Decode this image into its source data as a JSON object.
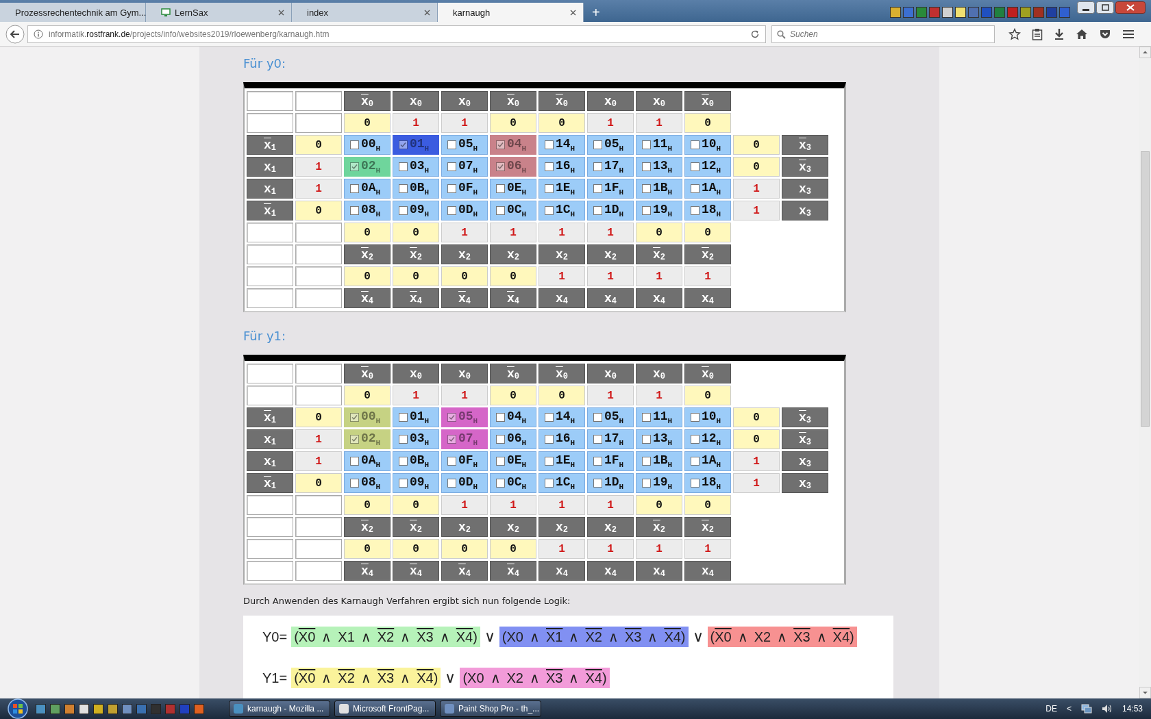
{
  "browser": {
    "tabs": [
      {
        "title": "Prozessrechentechnik am Gym...",
        "selected": false,
        "favicon": false,
        "closable": false
      },
      {
        "title": "LernSax",
        "selected": false,
        "favicon": true,
        "closable": true
      },
      {
        "title": "index",
        "selected": false,
        "favicon": false,
        "closable": true
      },
      {
        "title": "karnaugh",
        "selected": true,
        "favicon": false,
        "closable": true
      }
    ],
    "new_tab": "+",
    "url": {
      "prefix": "informatik.",
      "domain": "rostfrank.de",
      "path": "/projects/info/websites2019/rloewenberg/karnaugh.htm"
    },
    "search": {
      "placeholder": "Suchen"
    }
  },
  "maps": [
    {
      "heading": "Für y0:",
      "top_headers": [
        {
          "name": "x",
          "sub": "0",
          "negated": true
        },
        {
          "name": "x",
          "sub": "0",
          "negated": false
        },
        {
          "name": "x",
          "sub": "0",
          "negated": false
        },
        {
          "name": "x",
          "sub": "0",
          "negated": true
        },
        {
          "name": "x",
          "sub": "0",
          "negated": true
        },
        {
          "name": "x",
          "sub": "0",
          "negated": false
        },
        {
          "name": "x",
          "sub": "0",
          "negated": false
        },
        {
          "name": "x",
          "sub": "0",
          "negated": true
        }
      ],
      "top_values": [
        {
          "text": "0",
          "on": false
        },
        {
          "text": "1",
          "on": true
        },
        {
          "text": "1",
          "on": true
        },
        {
          "text": "0",
          "on": false
        },
        {
          "text": "0",
          "on": false
        },
        {
          "text": "1",
          "on": true
        },
        {
          "text": "1",
          "on": true
        },
        {
          "text": "0",
          "on": false
        }
      ],
      "rows": [
        {
          "left_header": {
            "name": "x",
            "sub": "1",
            "negated": true
          },
          "left_value": {
            "text": "0",
            "on": false
          },
          "right_value": {
            "text": "0",
            "on": false
          },
          "right_header": {
            "name": "x",
            "sub": "3",
            "negated": true
          },
          "cells": [
            {
              "code": "00",
              "sub": "H",
              "checked": false
            },
            {
              "code": "01",
              "sub": "H",
              "checked": true,
              "color": "#3b5ce0"
            },
            {
              "code": "05",
              "sub": "H",
              "checked": false
            },
            {
              "code": "04",
              "sub": "H",
              "checked": true,
              "color": "#c9828a"
            },
            {
              "code": "14",
              "sub": "H",
              "checked": false
            },
            {
              "code": "05",
              "sub": "H",
              "checked": false
            },
            {
              "code": "11",
              "sub": "H",
              "checked": false
            },
            {
              "code": "10",
              "sub": "H",
              "checked": false
            }
          ]
        },
        {
          "left_header": {
            "name": "x",
            "sub": "1",
            "negated": false
          },
          "left_value": {
            "text": "1",
            "on": true
          },
          "right_value": {
            "text": "0",
            "on": false
          },
          "right_header": {
            "name": "x",
            "sub": "3",
            "negated": true
          },
          "cells": [
            {
              "code": "02",
              "sub": "H",
              "checked": true,
              "color": "#6fd59c"
            },
            {
              "code": "03",
              "sub": "H",
              "checked": false
            },
            {
              "code": "07",
              "sub": "H",
              "checked": false
            },
            {
              "code": "06",
              "sub": "H",
              "checked": true,
              "color": "#c9828a"
            },
            {
              "code": "16",
              "sub": "H",
              "checked": false
            },
            {
              "code": "17",
              "sub": "H",
              "checked": false
            },
            {
              "code": "13",
              "sub": "H",
              "checked": false
            },
            {
              "code": "12",
              "sub": "H",
              "checked": false
            }
          ]
        },
        {
          "left_header": {
            "name": "x",
            "sub": "1",
            "negated": false
          },
          "left_value": {
            "text": "1",
            "on": true
          },
          "right_value": {
            "text": "1",
            "on": true
          },
          "right_header": {
            "name": "x",
            "sub": "3",
            "negated": false
          },
          "cells": [
            {
              "code": "0A",
              "sub": "H",
              "checked": false
            },
            {
              "code": "0B",
              "sub": "H",
              "checked": false
            },
            {
              "code": "0F",
              "sub": "H",
              "checked": false
            },
            {
              "code": "0E",
              "sub": "H",
              "checked": false
            },
            {
              "code": "1E",
              "sub": "H",
              "checked": false
            },
            {
              "code": "1F",
              "sub": "H",
              "checked": false
            },
            {
              "code": "1B",
              "sub": "H",
              "checked": false
            },
            {
              "code": "1A",
              "sub": "H",
              "checked": false
            }
          ]
        },
        {
          "left_header": {
            "name": "x",
            "sub": "1",
            "negated": true
          },
          "left_value": {
            "text": "0",
            "on": false
          },
          "right_value": {
            "text": "1",
            "on": true
          },
          "right_header": {
            "name": "x",
            "sub": "3",
            "negated": false
          },
          "cells": [
            {
              "code": "08",
              "sub": "H",
              "checked": false
            },
            {
              "code": "09",
              "sub": "H",
              "checked": false
            },
            {
              "code": "0D",
              "sub": "H",
              "checked": false
            },
            {
              "code": "0C",
              "sub": "H",
              "checked": false
            },
            {
              "code": "1C",
              "sub": "H",
              "checked": false
            },
            {
              "code": "1D",
              "sub": "H",
              "checked": false
            },
            {
              "code": "19",
              "sub": "H",
              "checked": false
            },
            {
              "code": "18",
              "sub": "H",
              "checked": false
            }
          ]
        }
      ],
      "bottom_values_1": [
        {
          "text": "0",
          "on": false
        },
        {
          "text": "0",
          "on": false
        },
        {
          "text": "1",
          "on": true
        },
        {
          "text": "1",
          "on": true
        },
        {
          "text": "1",
          "on": true
        },
        {
          "text": "1",
          "on": true
        },
        {
          "text": "0",
          "on": false
        },
        {
          "text": "0",
          "on": false
        }
      ],
      "bottom_headers_1": [
        {
          "name": "x",
          "sub": "2",
          "negated": true
        },
        {
          "name": "x",
          "sub": "2",
          "negated": true
        },
        {
          "name": "x",
          "sub": "2",
          "negated": false
        },
        {
          "name": "x",
          "sub": "2",
          "negated": false
        },
        {
          "name": "x",
          "sub": "2",
          "negated": false
        },
        {
          "name": "x",
          "sub": "2",
          "negated": false
        },
        {
          "name": "x",
          "sub": "2",
          "negated": true
        },
        {
          "name": "x",
          "sub": "2",
          "negated": true
        }
      ],
      "bottom_values_2": [
        {
          "text": "0",
          "on": false
        },
        {
          "text": "0",
          "on": false
        },
        {
          "text": "0",
          "on": false
        },
        {
          "text": "0",
          "on": false
        },
        {
          "text": "1",
          "on": true
        },
        {
          "text": "1",
          "on": true
        },
        {
          "text": "1",
          "on": true
        },
        {
          "text": "1",
          "on": true
        }
      ],
      "bottom_headers_2": [
        {
          "name": "x",
          "sub": "4",
          "negated": true
        },
        {
          "name": "x",
          "sub": "4",
          "negated": true
        },
        {
          "name": "x",
          "sub": "4",
          "negated": true
        },
        {
          "name": "x",
          "sub": "4",
          "negated": true
        },
        {
          "name": "x",
          "sub": "4",
          "negated": false
        },
        {
          "name": "x",
          "sub": "4",
          "negated": false
        },
        {
          "name": "x",
          "sub": "4",
          "negated": false
        },
        {
          "name": "x",
          "sub": "4",
          "negated": false
        }
      ]
    },
    {
      "heading": "Für y1:",
      "top_headers": [
        {
          "name": "x",
          "sub": "0",
          "negated": true
        },
        {
          "name": "x",
          "sub": "0",
          "negated": false
        },
        {
          "name": "x",
          "sub": "0",
          "negated": false
        },
        {
          "name": "x",
          "sub": "0",
          "negated": true
        },
        {
          "name": "x",
          "sub": "0",
          "negated": true
        },
        {
          "name": "x",
          "sub": "0",
          "negated": false
        },
        {
          "name": "x",
          "sub": "0",
          "negated": false
        },
        {
          "name": "x",
          "sub": "0",
          "negated": true
        }
      ],
      "top_values": [
        {
          "text": "0",
          "on": false
        },
        {
          "text": "1",
          "on": true
        },
        {
          "text": "1",
          "on": true
        },
        {
          "text": "0",
          "on": false
        },
        {
          "text": "0",
          "on": false
        },
        {
          "text": "1",
          "on": true
        },
        {
          "text": "1",
          "on": true
        },
        {
          "text": "0",
          "on": false
        }
      ],
      "rows": [
        {
          "left_header": {
            "name": "x",
            "sub": "1",
            "negated": true
          },
          "left_value": {
            "text": "0",
            "on": false
          },
          "right_value": {
            "text": "0",
            "on": false
          },
          "right_header": {
            "name": "x",
            "sub": "3",
            "negated": true
          },
          "cells": [
            {
              "code": "00",
              "sub": "H",
              "checked": true,
              "color": "#c6d283"
            },
            {
              "code": "01",
              "sub": "H",
              "checked": false
            },
            {
              "code": "05",
              "sub": "H",
              "checked": true,
              "color": "#d566c8"
            },
            {
              "code": "04",
              "sub": "H",
              "checked": false
            },
            {
              "code": "14",
              "sub": "H",
              "checked": false
            },
            {
              "code": "05",
              "sub": "H",
              "checked": false
            },
            {
              "code": "11",
              "sub": "H",
              "checked": false
            },
            {
              "code": "10",
              "sub": "H",
              "checked": false
            }
          ]
        },
        {
          "left_header": {
            "name": "x",
            "sub": "1",
            "negated": false
          },
          "left_value": {
            "text": "1",
            "on": true
          },
          "right_value": {
            "text": "0",
            "on": false
          },
          "right_header": {
            "name": "x",
            "sub": "3",
            "negated": true
          },
          "cells": [
            {
              "code": "02",
              "sub": "H",
              "checked": true,
              "color": "#c6d283"
            },
            {
              "code": "03",
              "sub": "H",
              "checked": false
            },
            {
              "code": "07",
              "sub": "H",
              "checked": true,
              "color": "#d566c8"
            },
            {
              "code": "06",
              "sub": "H",
              "checked": false
            },
            {
              "code": "16",
              "sub": "H",
              "checked": false
            },
            {
              "code": "17",
              "sub": "H",
              "checked": false
            },
            {
              "code": "13",
              "sub": "H",
              "checked": false
            },
            {
              "code": "12",
              "sub": "H",
              "checked": false
            }
          ]
        },
        {
          "left_header": {
            "name": "x",
            "sub": "1",
            "negated": false
          },
          "left_value": {
            "text": "1",
            "on": true
          },
          "right_value": {
            "text": "1",
            "on": true
          },
          "right_header": {
            "name": "x",
            "sub": "3",
            "negated": false
          },
          "cells": [
            {
              "code": "0A",
              "sub": "H",
              "checked": false
            },
            {
              "code": "0B",
              "sub": "H",
              "checked": false
            },
            {
              "code": "0F",
              "sub": "H",
              "checked": false
            },
            {
              "code": "0E",
              "sub": "H",
              "checked": false
            },
            {
              "code": "1E",
              "sub": "H",
              "checked": false
            },
            {
              "code": "1F",
              "sub": "H",
              "checked": false
            },
            {
              "code": "1B",
              "sub": "H",
              "checked": false
            },
            {
              "code": "1A",
              "sub": "H",
              "checked": false
            }
          ]
        },
        {
          "left_header": {
            "name": "x",
            "sub": "1",
            "negated": true
          },
          "left_value": {
            "text": "0",
            "on": false
          },
          "right_value": {
            "text": "1",
            "on": true
          },
          "right_header": {
            "name": "x",
            "sub": "3",
            "negated": false
          },
          "cells": [
            {
              "code": "08",
              "sub": "H",
              "checked": false
            },
            {
              "code": "09",
              "sub": "H",
              "checked": false
            },
            {
              "code": "0D",
              "sub": "H",
              "checked": false
            },
            {
              "code": "0C",
              "sub": "H",
              "checked": false
            },
            {
              "code": "1C",
              "sub": "H",
              "checked": false
            },
            {
              "code": "1D",
              "sub": "H",
              "checked": false
            },
            {
              "code": "19",
              "sub": "H",
              "checked": false
            },
            {
              "code": "18",
              "sub": "H",
              "checked": false
            }
          ]
        }
      ],
      "bottom_values_1": [
        {
          "text": "0",
          "on": false
        },
        {
          "text": "0",
          "on": false
        },
        {
          "text": "1",
          "on": true
        },
        {
          "text": "1",
          "on": true
        },
        {
          "text": "1",
          "on": true
        },
        {
          "text": "1",
          "on": true
        },
        {
          "text": "0",
          "on": false
        },
        {
          "text": "0",
          "on": false
        }
      ],
      "bottom_headers_1": [
        {
          "name": "x",
          "sub": "2",
          "negated": true
        },
        {
          "name": "x",
          "sub": "2",
          "negated": true
        },
        {
          "name": "x",
          "sub": "2",
          "negated": false
        },
        {
          "name": "x",
          "sub": "2",
          "negated": false
        },
        {
          "name": "x",
          "sub": "2",
          "negated": false
        },
        {
          "name": "x",
          "sub": "2",
          "negated": false
        },
        {
          "name": "x",
          "sub": "2",
          "negated": true
        },
        {
          "name": "x",
          "sub": "2",
          "negated": true
        }
      ],
      "bottom_values_2": [
        {
          "text": "0",
          "on": false
        },
        {
          "text": "0",
          "on": false
        },
        {
          "text": "0",
          "on": false
        },
        {
          "text": "0",
          "on": false
        },
        {
          "text": "1",
          "on": true
        },
        {
          "text": "1",
          "on": true
        },
        {
          "text": "1",
          "on": true
        },
        {
          "text": "1",
          "on": true
        }
      ],
      "bottom_headers_2": [
        {
          "name": "x",
          "sub": "4",
          "negated": true
        },
        {
          "name": "x",
          "sub": "4",
          "negated": true
        },
        {
          "name": "x",
          "sub": "4",
          "negated": true
        },
        {
          "name": "x",
          "sub": "4",
          "negated": true
        },
        {
          "name": "x",
          "sub": "4",
          "negated": false
        },
        {
          "name": "x",
          "sub": "4",
          "negated": false
        },
        {
          "name": "x",
          "sub": "4",
          "negated": false
        },
        {
          "name": "x",
          "sub": "4",
          "negated": false
        }
      ]
    }
  ],
  "logic": {
    "intro": "Durch Anwenden des Karnaugh Verfahren ergibt sich nun folgende Logik:",
    "and": "∧",
    "or": "∨",
    "open": "(",
    "close": ")",
    "equations": [
      {
        "label": "Y0=",
        "terms": [
          {
            "color": "#b6f2b9",
            "literals": [
              {
                "name": "X0",
                "negated": true
              },
              {
                "name": "X1",
                "negated": false
              },
              {
                "name": "X2",
                "negated": true
              },
              {
                "name": "X3",
                "negated": true
              },
              {
                "name": "X4",
                "negated": true
              }
            ]
          },
          {
            "color": "#8190f2",
            "literals": [
              {
                "name": "X0",
                "negated": false
              },
              {
                "name": "X1",
                "negated": true
              },
              {
                "name": "X2",
                "negated": true
              },
              {
                "name": "X3",
                "negated": true
              },
              {
                "name": "X4",
                "negated": true
              }
            ]
          },
          {
            "color": "#f79191",
            "literals": [
              {
                "name": "X0",
                "negated": true
              },
              {
                "name": "X2",
                "negated": false
              },
              {
                "name": "X3",
                "negated": true
              },
              {
                "name": "X4",
                "negated": true
              }
            ]
          }
        ]
      },
      {
        "label": "Y1=",
        "terms": [
          {
            "color": "#faf39b",
            "literals": [
              {
                "name": "X0",
                "negated": true
              },
              {
                "name": "X2",
                "negated": true
              },
              {
                "name": "X3",
                "negated": true
              },
              {
                "name": "X4",
                "negated": true
              }
            ]
          },
          {
            "color": "#f29bd9",
            "literals": [
              {
                "name": "X0",
                "negated": false
              },
              {
                "name": "X2",
                "negated": false
              },
              {
                "name": "X3",
                "negated": true
              },
              {
                "name": "X4",
                "negated": true
              }
            ]
          }
        ]
      }
    ]
  },
  "taskbar": {
    "tasks": [
      {
        "label": "karnaugh - Mozilla ..."
      },
      {
        "label": "Microsoft FrontPag..."
      },
      {
        "label": "Paint Shop Pro - th_..."
      }
    ],
    "language": "DE",
    "tray_arrow": "<",
    "clock": "14:53"
  }
}
